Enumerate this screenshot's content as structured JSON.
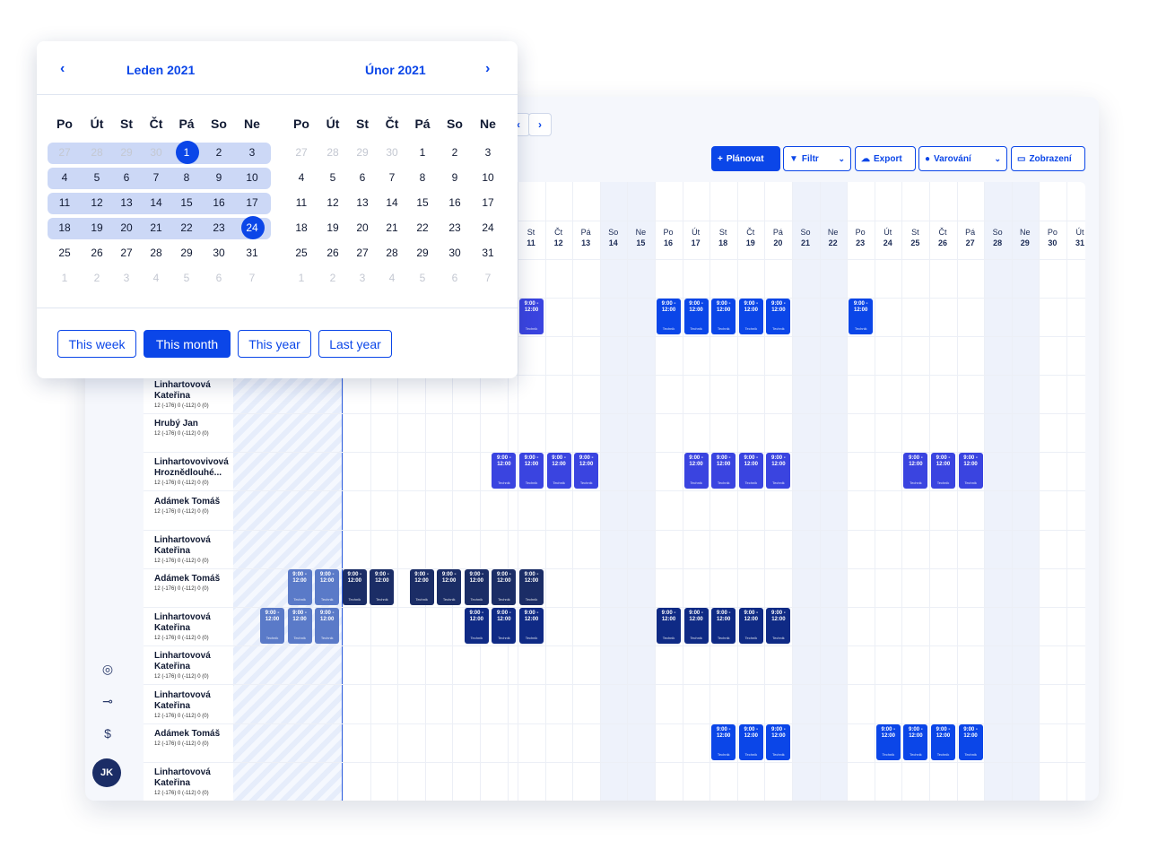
{
  "toolbar": {
    "plan": "Plánovat",
    "filter": "Filtr",
    "export": "Export",
    "warnings": "Varování",
    "view": "Zobrazení",
    "prev": "‹",
    "next": "›"
  },
  "avatar": "JK",
  "day_headers": [
    {
      "name": "St",
      "num": "11"
    },
    {
      "name": "Čt",
      "num": "12"
    },
    {
      "name": "Pá",
      "num": "13"
    },
    {
      "name": "So",
      "num": "14"
    },
    {
      "name": "Ne",
      "num": "15"
    },
    {
      "name": "Po",
      "num": "16"
    },
    {
      "name": "Út",
      "num": "17"
    },
    {
      "name": "St",
      "num": "18"
    },
    {
      "name": "Čt",
      "num": "19"
    },
    {
      "name": "Pá",
      "num": "20"
    },
    {
      "name": "So",
      "num": "21"
    },
    {
      "name": "Ne",
      "num": "22"
    },
    {
      "name": "Po",
      "num": "23"
    },
    {
      "name": "Út",
      "num": "24"
    },
    {
      "name": "St",
      "num": "25"
    },
    {
      "name": "Čt",
      "num": "26"
    },
    {
      "name": "Pá",
      "num": "27"
    },
    {
      "name": "So",
      "num": "28"
    },
    {
      "name": "Ne",
      "num": "29"
    },
    {
      "name": "Po",
      "num": "30"
    },
    {
      "name": "Út",
      "num": "31"
    }
  ],
  "shift": {
    "time_start": "9:00 -",
    "time_end": "12:00",
    "role": "Technik"
  },
  "employees": [
    {
      "name": "Linhartovová Kateřina",
      "stats": "12 (-176)   0 (-112)   0 (0)"
    },
    {
      "name": "Hrubý Jan",
      "stats": "12 (-176)   0 (-112)   0 (0)"
    },
    {
      "name": "Linhartovovivová Hroznědlouhé...",
      "stats": "12 (-176)   0 (-112)   0 (0)"
    },
    {
      "name": "Adámek Tomáš",
      "stats": "12 (-176)   0 (-112)   0 (0)"
    },
    {
      "name": "Linhartovová Kateřina",
      "stats": "12 (-176)   0 (-112)   0 (0)"
    },
    {
      "name": "Adámek Tomáš",
      "stats": "12 (-176)   0 (-112)   0 (0)"
    },
    {
      "name": "Linhartovová Kateřina",
      "stats": "12 (-176)   0 (-112)   0 (0)"
    },
    {
      "name": "Linhartovová Kateřina",
      "stats": "12 (-176)   0 (-112)   0 (0)"
    },
    {
      "name": "Linhartovová Kateřina",
      "stats": "12 (-176)   0 (-112)   0 (0)"
    },
    {
      "name": "Adámek Tomáš",
      "stats": "12 (-176)   0 (-112)   0 (0)"
    },
    {
      "name": "Linhartovová Kateřina",
      "stats": "12 (-176)   0 (-112)   0 (0)"
    }
  ],
  "datepicker": {
    "left_month": "Leden 2021",
    "right_month": "Únor 2021",
    "prev": "‹",
    "next": "›",
    "weekdays": [
      "Po",
      "Út",
      "St",
      "Čt",
      "Pá",
      "So",
      "Ne"
    ],
    "left_days": [
      "27",
      "28",
      "29",
      "30",
      "1",
      "2",
      "3",
      "4",
      "5",
      "6",
      "7",
      "8",
      "9",
      "10",
      "11",
      "12",
      "13",
      "14",
      "15",
      "16",
      "17",
      "18",
      "19",
      "20",
      "21",
      "22",
      "23",
      "24",
      "25",
      "26",
      "27",
      "28",
      "29",
      "30",
      "31",
      "1",
      "2",
      "3",
      "4",
      "5",
      "6",
      "7"
    ],
    "right_days": [
      "27",
      "28",
      "29",
      "30",
      "1",
      "2",
      "3",
      "4",
      "5",
      "6",
      "7",
      "8",
      "9",
      "10",
      "11",
      "12",
      "13",
      "14",
      "15",
      "16",
      "17",
      "18",
      "19",
      "20",
      "21",
      "22",
      "23",
      "24",
      "25",
      "26",
      "27",
      "28",
      "29",
      "30",
      "31",
      "1",
      "2",
      "3",
      "4",
      "5",
      "6",
      "7"
    ],
    "range_start": "1",
    "range_end": "24",
    "quick": [
      "This week",
      "This month",
      "This year",
      "Last year"
    ],
    "quick_active": "This month"
  }
}
